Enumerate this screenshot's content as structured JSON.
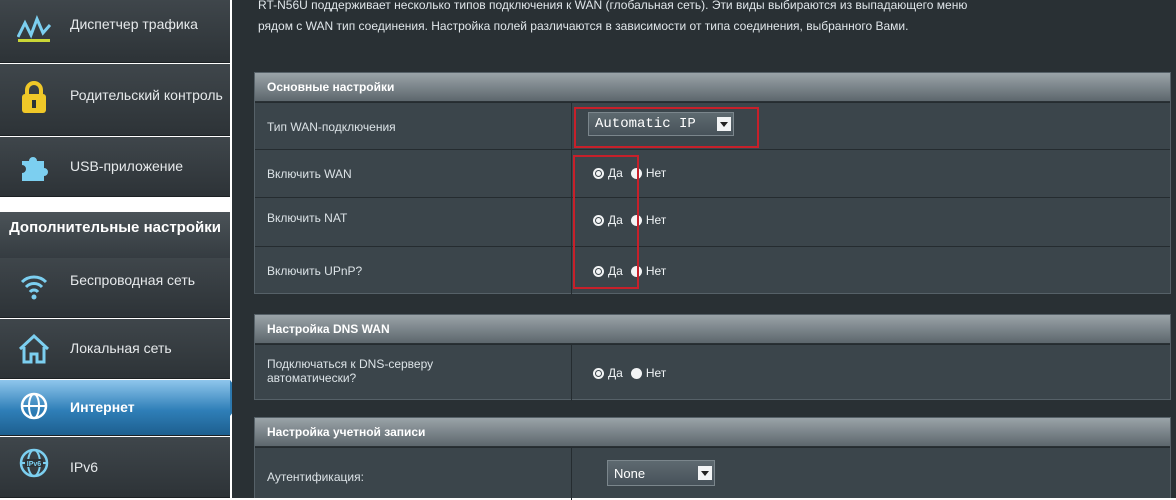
{
  "sidebar": {
    "items": [
      {
        "label": "Диспетчер трафика",
        "icon": "traffic-manager-icon"
      },
      {
        "label": "Родительский контроль",
        "icon": "lock-icon"
      },
      {
        "label": "USB-приложение",
        "icon": "puzzle-icon"
      },
      {
        "label": "Беспроводная сеть",
        "icon": "wifi-icon"
      },
      {
        "label": "Локальная сеть",
        "icon": "home-icon"
      },
      {
        "label": "Интернет",
        "icon": "globe-icon"
      },
      {
        "label": "IPv6",
        "icon": "ipv6-globe-icon"
      }
    ],
    "header": "Дополнительные настройки",
    "active": "Интернет"
  },
  "intro": {
    "line1": "RT-N56U поддерживает несколько типов подключения к WAN (глобальная сеть). Эти виды выбираются из выпадающего меню",
    "line2": "рядом с WAN тип соединения. Настройка полей различаются в зависимости от типа соединения, выбранного Вами."
  },
  "basic": {
    "title": "Основные настройки",
    "wan_type_label": "Тип WAN-подключения",
    "wan_type_value": "Automatic IP",
    "enable_wan_label": "Включить WAN",
    "enable_nat_label": "Включить NAT",
    "enable_upnp_label": "Включить UPnP?"
  },
  "dns": {
    "title": "Настройка DNS WAN",
    "auto_label": "Подключаться к DNS-серверу автоматически?"
  },
  "account": {
    "title": "Настройка учетной записи",
    "auth_label": "Аутентификация:",
    "auth_value": "None"
  },
  "radio": {
    "yes": "Да",
    "no": "Нет"
  },
  "colors": {
    "accent": "#2f7fb8",
    "highlight": "#c7202a"
  }
}
